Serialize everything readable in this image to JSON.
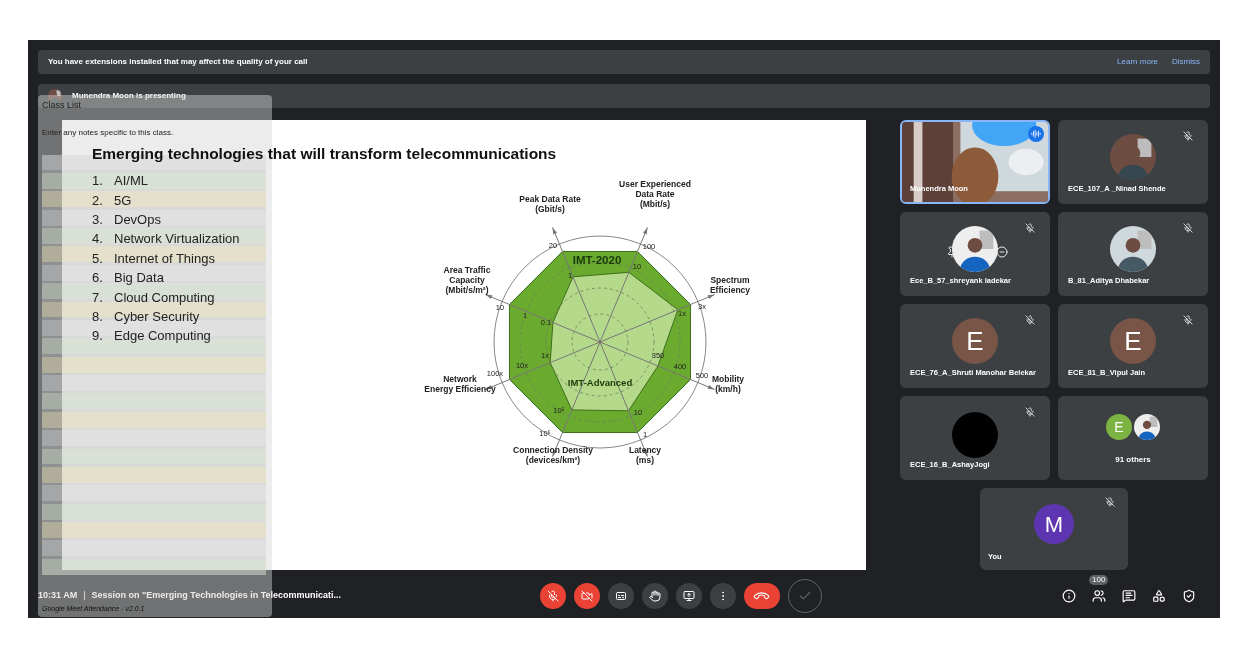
{
  "banner": {
    "text": "You have extensions installed that may affect the quality of your call",
    "links": [
      "Learn more",
      "Dismiss"
    ]
  },
  "presenting": {
    "text": "Munendra Moon is presenting"
  },
  "attendance_panel": {
    "title": "Class List",
    "notes_placeholder": "Enter any notes specific to this class.",
    "footer": "Google Meet Attendance - v2.0.1"
  },
  "slide": {
    "title": "Emerging technologies that will transform telecommunications",
    "items": [
      {
        "number": "1.",
        "text": "AI/ML"
      },
      {
        "number": "2.",
        "text": "5G"
      },
      {
        "number": "3.",
        "text": "DevOps"
      },
      {
        "number": "4.",
        "text": "Network Virtualization"
      },
      {
        "number": "5.",
        "text": "Internet of Things"
      },
      {
        "number": "6.",
        "text": "Big Data"
      },
      {
        "number": "7.",
        "text": "Cloud Computing"
      },
      {
        "number": "8.",
        "text": "Cyber Security"
      },
      {
        "number": "9.",
        "text": "Edge Computing"
      }
    ],
    "diagram": {
      "outer_label": "IMT-2020",
      "inner_label": "IMT-Advanced",
      "axes": [
        {
          "label": [
            "Peak Data Rate",
            "(Gbit/s)"
          ],
          "ticks": [
            "20",
            "1"
          ]
        },
        {
          "label": [
            "User Experienced",
            "Data Rate",
            "(Mbit/s)"
          ],
          "ticks": [
            "100",
            "10"
          ]
        },
        {
          "label": [
            "Area Traffic",
            "Capacity",
            "(Mbit/s/m²)"
          ],
          "ticks": [
            "10",
            "1",
            "0.1"
          ]
        },
        {
          "label": [
            "Spectrum",
            "Efficiency"
          ],
          "ticks": [
            "3x",
            "1x"
          ]
        },
        {
          "label": [
            "Network",
            "Energy Efficiency"
          ],
          "ticks": [
            "100x",
            "10x",
            "1x"
          ]
        },
        {
          "label": [
            "Mobility",
            "(km/h)"
          ],
          "ticks": [
            "500",
            "400",
            "350"
          ]
        },
        {
          "label": [
            "Connection Density",
            "(devices/km²)"
          ],
          "ticks": [
            "10⁶",
            "10⁵"
          ]
        },
        {
          "label": [
            "Latency",
            "(ms)"
          ],
          "ticks": [
            "1",
            "10"
          ]
        }
      ]
    }
  },
  "tiles": [
    {
      "kind": "video",
      "name": "Munendra Moon",
      "muted": false,
      "speaking": true
    },
    {
      "name": "ECE_107_A _Ninad Shende",
      "muted": true,
      "speaking": false
    },
    {
      "name": "Ece_B_57_shreyank ladekar",
      "muted": true,
      "speaking": false,
      "hovered": true
    },
    {
      "name": "B_81_Aditya Dhabekar",
      "muted": true,
      "speaking": false
    },
    {
      "kind": "letter",
      "name": "ECE_76_A_Shruti Manohar Belekar",
      "initial": "E",
      "color": "#795548",
      "muted": true,
      "speaking": false
    },
    {
      "kind": "letter",
      "name": "ECE_81_B_Vipul Jain",
      "initial": "E",
      "color": "#795548",
      "muted": true,
      "speaking": false
    },
    {
      "kind": "dark",
      "name": "ECE_16_B_AshayJogi",
      "muted": true,
      "speaking": false
    },
    {
      "kind": "others",
      "name": "91 others",
      "initial": "E",
      "color": "#7cb342",
      "muted": false,
      "speaking": false
    }
  ],
  "self_tile": {
    "name": "You",
    "initial": "M",
    "color": "#5e35b1",
    "muted": true
  },
  "bottom_bar": {
    "time": "10:31 AM",
    "separator": "|",
    "meeting_title": "Session on \"Emerging Technologies in Telecommunicati...",
    "controls": [
      {
        "kind": "mic",
        "on": false
      },
      {
        "kind": "camera",
        "on": false
      },
      {
        "kind": "captions",
        "on": false
      },
      {
        "kind": "hand"
      },
      {
        "kind": "present"
      },
      {
        "kind": "more"
      },
      {
        "kind": "end"
      },
      {
        "kind": "extension"
      }
    ],
    "side_buttons": [
      {
        "kind": "info"
      },
      {
        "kind": "people",
        "badge": "100"
      },
      {
        "kind": "chat"
      },
      {
        "kind": "activities"
      },
      {
        "kind": "host"
      }
    ]
  }
}
